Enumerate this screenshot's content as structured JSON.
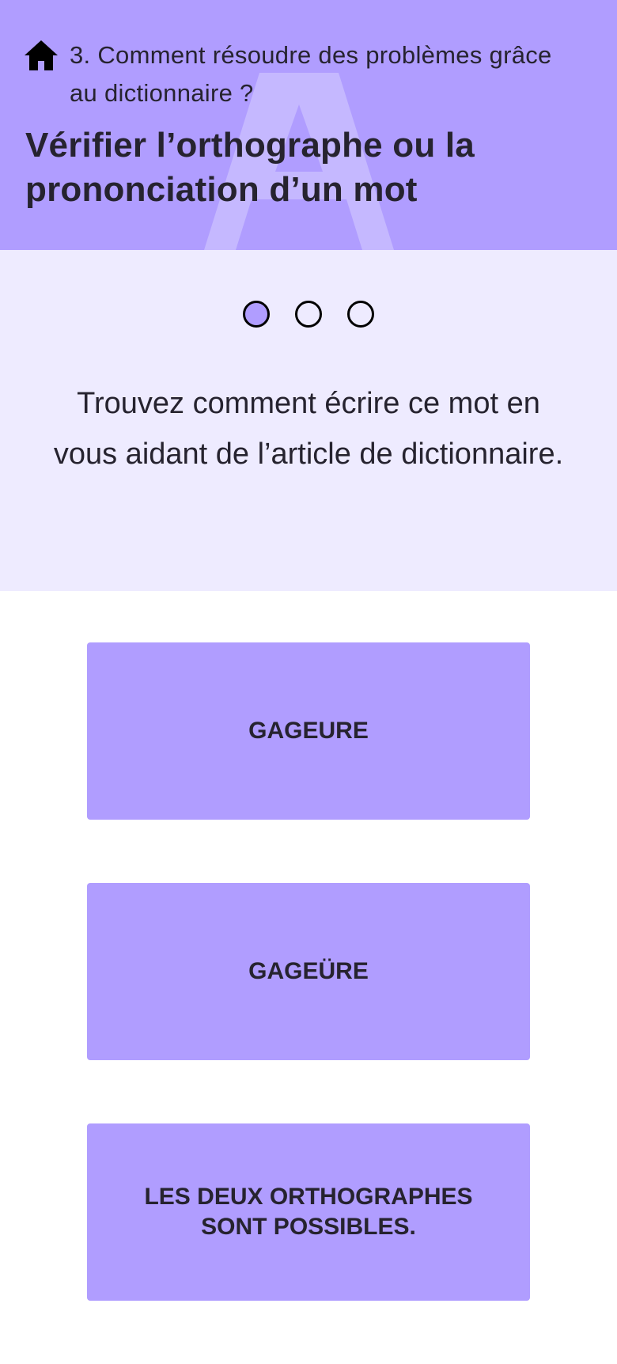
{
  "header": {
    "breadcrumb": "3. Comment résoudre des problèmes grâce au dictionnaire ?",
    "title": "Vérifier l’orthographe ou la prononciation d’un mot",
    "home_icon": "home-icon",
    "watermark_letter": "A",
    "background_color": "#b09dff"
  },
  "progress": {
    "total_steps": 3,
    "current_step": 1,
    "active_color": "#b09dff"
  },
  "question": {
    "instruction": "Trouvez comment écrire ce mot en vous aidant de l’article de dictionnaire.",
    "background_color": "#eeebff"
  },
  "answers": [
    {
      "label": "GAGEURE"
    },
    {
      "label": "GAGEÜRE"
    },
    {
      "label": "LES DEUX ORTHOGRAPHES SONT POSSIBLES."
    }
  ]
}
